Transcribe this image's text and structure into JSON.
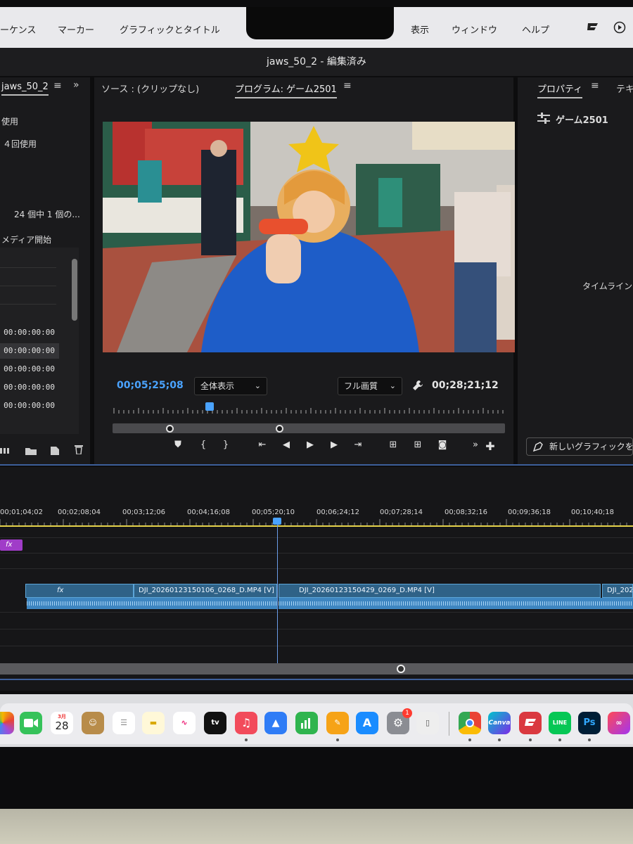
{
  "menubar": {
    "items": [
      "ーケンス",
      "マーカー",
      "グラフィックとタイトル",
      "表示",
      "ウィンドウ",
      "ヘルプ"
    ]
  },
  "window": {
    "title": "jaws_50_2 - 編集済み"
  },
  "project_panel": {
    "tab": "jaws_50_2",
    "line1": "使用",
    "line2": "４回使用",
    "count": "24 個中 1 個の...",
    "column": "メディア開始",
    "timecodes": [
      "00:00:00:00",
      "00:00:00:00",
      "00:00:00:00",
      "00:00:00:00",
      "00:00:00:00"
    ]
  },
  "program_panel": {
    "source_tab": "ソース : (クリップなし)",
    "program_tab": "プログラム: ゲーム2501",
    "current_tc": "00;05;25;08",
    "zoom": "全体表示",
    "quality": "フル画質",
    "duration_tc": "00;28;21;12"
  },
  "props_panel": {
    "tab1": "プロパティ",
    "tab2": "テキ",
    "sequence": "ゲーム2501",
    "timeline_label": "タイムライン",
    "new_graphic": "新しいグラフィックを"
  },
  "timeline": {
    "ruler": [
      "00;01;04;02",
      "00;02;08;04",
      "00;03;12;06",
      "00;04;16;08",
      "00;05;20;10",
      "00;06;24;12",
      "00;07;28;14",
      "00;08;32;16",
      "00;09;36;18",
      "00;10;40;18"
    ],
    "fx": "fx",
    "clips": [
      "DJI_20260123150106_0268_D.MP4 [V]",
      "DJI_20260123150429_0269_D.MP4 [V]",
      "DJI_2026"
    ]
  },
  "dock": {
    "calendar_month": "3月",
    "calendar_day": "28",
    "settings_badge": "1",
    "canva": "Canva",
    "line": "LINE",
    "ps": "Ps"
  }
}
